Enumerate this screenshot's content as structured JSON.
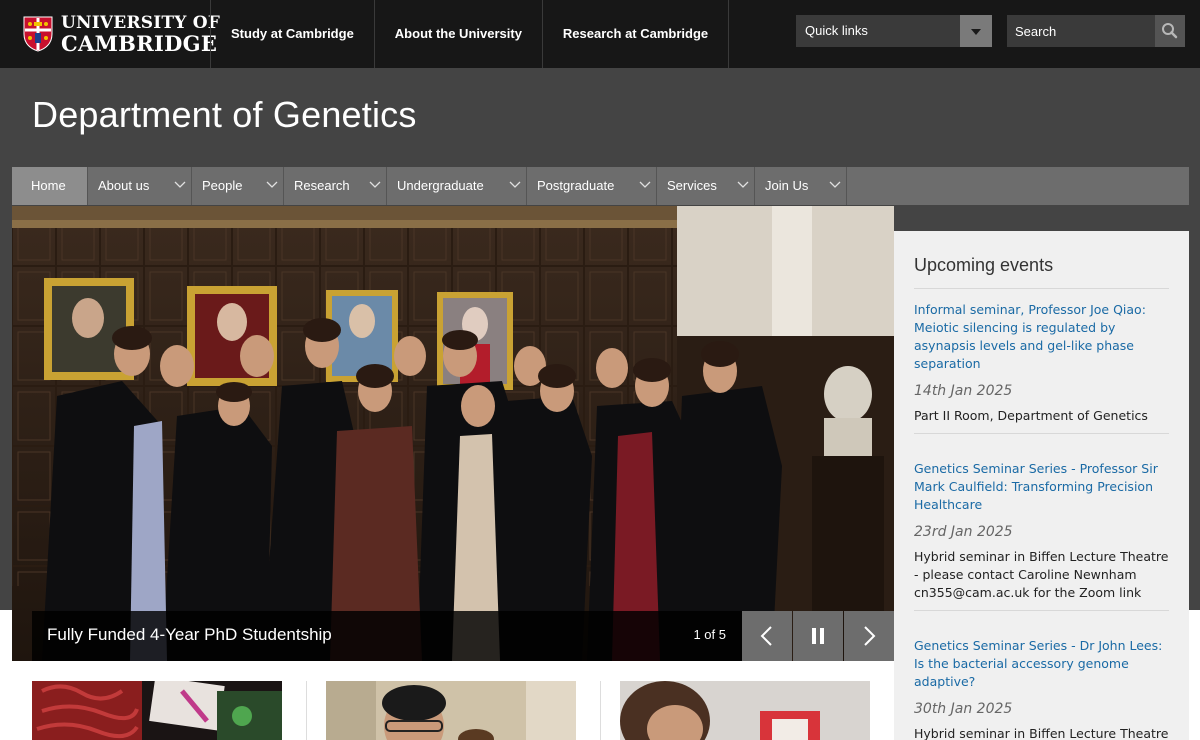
{
  "header": {
    "logo_line1": "UNIVERSITY OF",
    "logo_line2": "CAMBRIDGE",
    "nav": [
      "Study at Cambridge",
      "About the University",
      "Research at Cambridge"
    ],
    "quicklinks_label": "Quick links",
    "search_placeholder": "Search"
  },
  "department": {
    "title": "Department of Genetics"
  },
  "mainnav": {
    "items": [
      {
        "label": "Home",
        "active": true
      },
      {
        "label": "About us"
      },
      {
        "label": "People"
      },
      {
        "label": "Research"
      },
      {
        "label": "Undergraduate"
      },
      {
        "label": "Postgraduate"
      },
      {
        "label": "Services"
      },
      {
        "label": "Join Us"
      }
    ]
  },
  "carousel": {
    "caption": "Fully Funded 4-Year PhD Studentship",
    "counter": "1 of 5"
  },
  "events": {
    "heading": "Upcoming events",
    "items": [
      {
        "title": "Informal seminar, Professor Joe Qiao: Meiotic silencing is regulated by asynapsis levels and gel-like phase separation",
        "date": "14th Jan 2025",
        "location": "Part II Room, Department of Genetics"
      },
      {
        "title": "Genetics Seminar Series - Professor Sir Mark Caulfield: Transforming Precision Healthcare",
        "date": "23rd Jan 2025",
        "location": "Hybrid seminar in Biffen Lecture Theatre - please contact Caroline Newnham cn355@cam.ac.uk for the Zoom link"
      },
      {
        "title": "Genetics Seminar Series - Dr John Lees: Is the bacterial accessory genome adaptive?",
        "date": "30th Jan 2025",
        "location": "Hybrid seminar in Biffen Lecture Theatre"
      }
    ]
  },
  "colors": {
    "topbar": "#171717",
    "band": "#444444",
    "nav": "#6d6d6d",
    "link": "#1a6aa5",
    "events_bg": "#f0f0f0"
  }
}
